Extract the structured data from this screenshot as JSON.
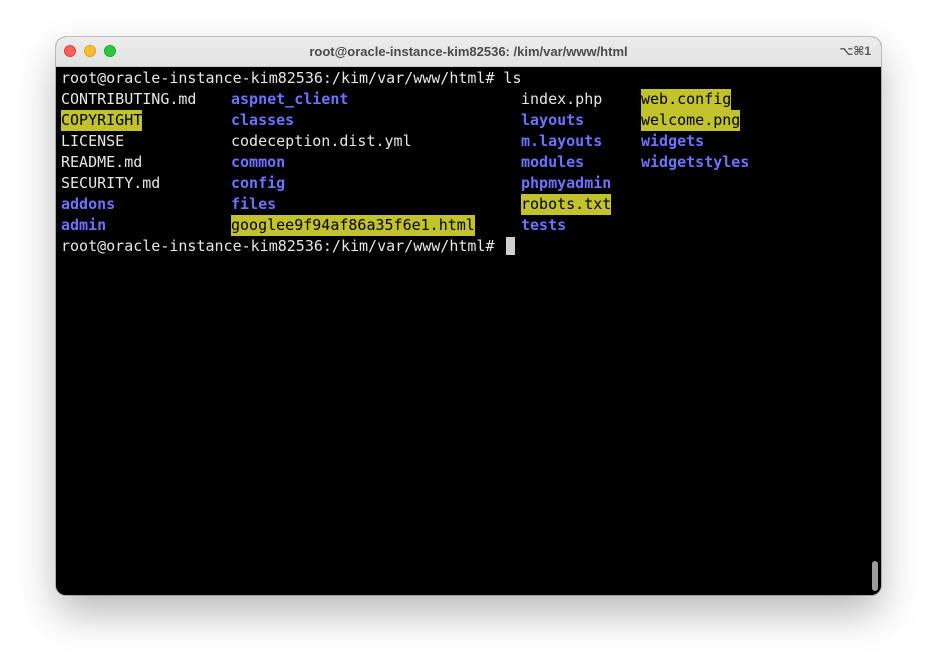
{
  "window": {
    "title": "root@oracle-instance-kim82536: /kim/var/www/html",
    "shortcut": "⌥⌘1"
  },
  "terminal": {
    "prompt_command": "root@oracle-instance-kim82536:/kim/var/www/html# ls",
    "prompt_current": "root@oracle-instance-kim82536:/kim/var/www/html# ",
    "listing": {
      "col1": [
        {
          "name": "CONTRIBUTING.md",
          "style": "plain"
        },
        {
          "name": "COPYRIGHT",
          "style": "hl"
        },
        {
          "name": "LICENSE",
          "style": "plain"
        },
        {
          "name": "README.md",
          "style": "plain"
        },
        {
          "name": "SECURITY.md",
          "style": "plain"
        },
        {
          "name": "addons",
          "style": "dir"
        },
        {
          "name": "admin",
          "style": "dir"
        }
      ],
      "col2": [
        {
          "name": "aspnet_client",
          "style": "dir"
        },
        {
          "name": "classes",
          "style": "dir"
        },
        {
          "name": "codeception.dist.yml",
          "style": "plain"
        },
        {
          "name": "common",
          "style": "dir"
        },
        {
          "name": "config",
          "style": "dir"
        },
        {
          "name": "files",
          "style": "dir"
        },
        {
          "name": "googlee9f94af86a35f6e1.html",
          "style": "hl"
        }
      ],
      "col3": [
        {
          "name": "index.php",
          "style": "plain"
        },
        {
          "name": "layouts",
          "style": "dir"
        },
        {
          "name": "m.layouts",
          "style": "dir"
        },
        {
          "name": "modules",
          "style": "dir"
        },
        {
          "name": "phpmyadmin",
          "style": "dir"
        },
        {
          "name": "robots.txt",
          "style": "hl"
        },
        {
          "name": "tests",
          "style": "dir"
        }
      ],
      "col4": [
        {
          "name": "web.config",
          "style": "hl"
        },
        {
          "name": "welcome.png",
          "style": "hl"
        },
        {
          "name": "widgets",
          "style": "dir"
        },
        {
          "name": "widgetstyles",
          "style": "dir"
        }
      ]
    }
  },
  "colors": {
    "directory": "#6b73ff",
    "highlight_bg": "#c2c22b",
    "plain_text": "#e6e6e6",
    "background": "#000000"
  }
}
